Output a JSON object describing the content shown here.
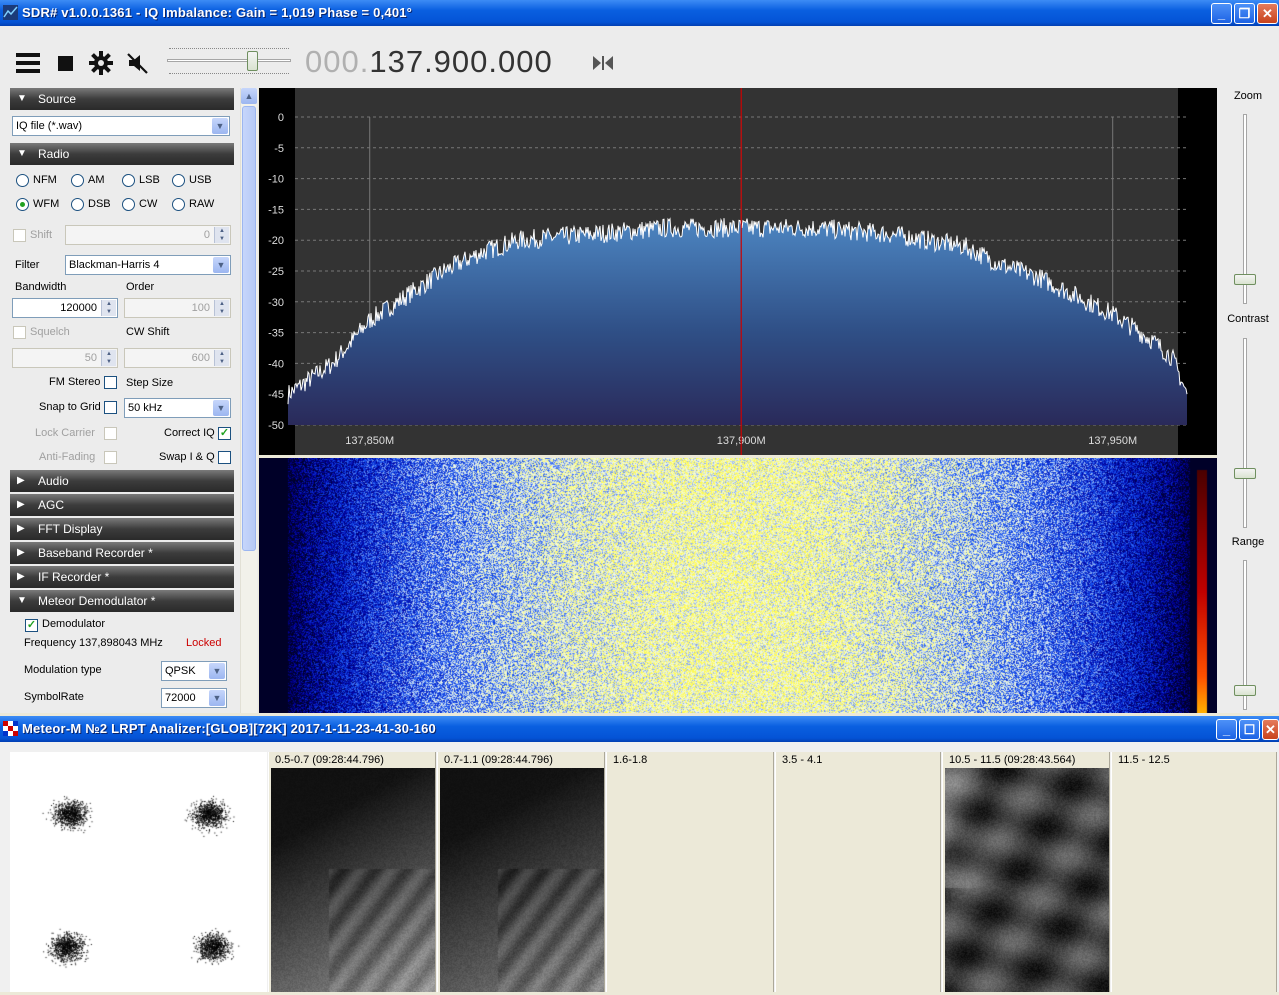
{
  "sdr": {
    "title": "SDR# v1.0.0.1361 - IQ Imbalance: Gain = 1,019 Phase = 0,401°",
    "freq_dim": "000.",
    "freq_main": "137.900.000",
    "sections": {
      "source": "Source",
      "radio": "Radio",
      "audio": "Audio",
      "agc": "AGC",
      "fft": "FFT Display",
      "baseband": "Baseband Recorder *",
      "if": "IF Recorder *",
      "meteor": "Meteor Demodulator *"
    },
    "source_value": "IQ file (*.wav)",
    "modes": [
      "NFM",
      "AM",
      "LSB",
      "USB",
      "WFM",
      "DSB",
      "CW",
      "RAW"
    ],
    "selected_mode": "WFM",
    "shift_label": "Shift",
    "shift_value": "0",
    "filter_label": "Filter",
    "filter_value": "Blackman-Harris 4",
    "bandwidth_label": "Bandwidth",
    "bandwidth_value": "120000",
    "order_label": "Order",
    "order_value": "100",
    "squelch_label": "Squelch",
    "squelch_value": "50",
    "cwshift_label": "CW Shift",
    "cwshift_value": "600",
    "fmstereo_label": "FM Stereo",
    "stepsize_label": "Step Size",
    "snap_label": "Snap to Grid",
    "step_value": "50 kHz",
    "lockcarrier_label": "Lock Carrier",
    "correctiq_label": "Correct IQ",
    "antifading_label": "Anti-Fading",
    "swapiq_label": "Swap I & Q",
    "demod": {
      "demodulator_label": "Demodulator",
      "frequency_text": "Frequency 137,898043 MHz",
      "status": "Locked",
      "modtype_label": "Modulation type",
      "modtype_value": "QPSK",
      "symbolrate_label": "SymbolRate",
      "symbolrate_value": "72000"
    },
    "right": {
      "zoom": "Zoom",
      "contrast": "Contrast",
      "range": "Range"
    },
    "colors": {
      "accent": "#0453d6",
      "locked": "#cc0000",
      "spectrum_fill": "#3a6aa8",
      "marker": "#cc0000"
    }
  },
  "chart_data": {
    "type": "area",
    "x_ticks": [
      "137,850M",
      "137,900M",
      "137,950M"
    ],
    "y_ticks": [
      0,
      -5,
      -10,
      -15,
      -20,
      -25,
      -30,
      -35,
      -40,
      -45,
      -50
    ],
    "ylim": [
      -50,
      0
    ],
    "xlim": [
      137.839,
      137.96
    ],
    "marker_x": 137.9,
    "grid": true,
    "x": [
      137.839,
      137.845,
      137.85,
      137.855,
      137.86,
      137.865,
      137.87,
      137.88,
      137.89,
      137.9,
      137.91,
      137.92,
      137.93,
      137.935,
      137.94,
      137.945,
      137.95,
      137.955,
      137.958,
      137.96
    ],
    "values": [
      -45,
      -40,
      -33,
      -29,
      -25,
      -22,
      -20,
      -19,
      -18,
      -18,
      -18,
      -19,
      -21,
      -24,
      -26,
      -29,
      -32,
      -36,
      -39,
      -45
    ]
  },
  "meteor": {
    "title": "Meteor-M №2 LRPT Analizer:[GLOB][72K] 2017-1-11-23-41-30-160",
    "channels": [
      "0.5-0.7 (09:28:44.796)",
      "0.7-1.1 (09:28:44.796)",
      "1.6-1.8",
      "3.5 - 4.1",
      "10.5 - 11.5 (09:28:43.564)",
      "11.5 - 12.5"
    ]
  }
}
